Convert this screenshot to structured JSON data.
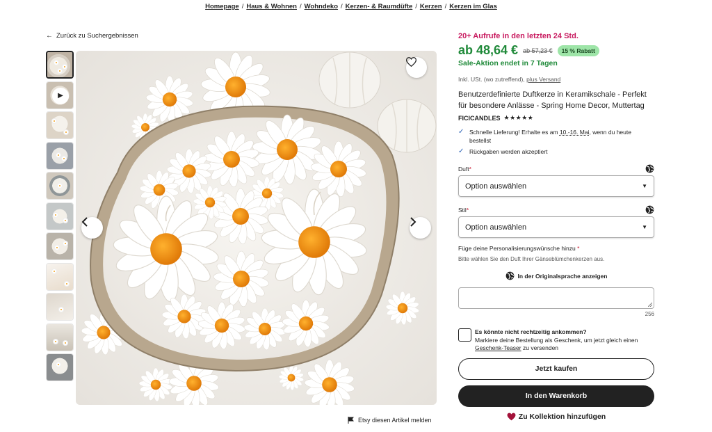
{
  "breadcrumb": {
    "items": [
      "Homepage",
      "Haus & Wohnen",
      "Wohndeko",
      "Kerzen- & Raumdüfte",
      "Kerzen",
      "Kerzen im Glas"
    ],
    "separator": "/"
  },
  "back_link": "Zurück zu Suchergebnissen",
  "gallery": {
    "report_link": "Etsy diesen Artikel melden"
  },
  "product": {
    "views_text": "20+ Aufrufe in den letzten 24 Std.",
    "price": "ab 48,64 €",
    "old_price": "ab 57,23 €",
    "discount_badge": "15 % Rabatt",
    "sale_end": "Sale-Aktion endet in 7 Tagen",
    "tax_text": "Inkl. USt. (wo zutreffend),",
    "shipping_link": "plus Versand",
    "title": "Benutzerdefinierte Duftkerze in Keramikschale - Perfekt für besondere Anlässe - Spring Home Decor, Muttertag",
    "shop_name": "FICICANDLES",
    "stars": "★★★★★"
  },
  "features": {
    "delivery_prefix": "Schnelle Lieferung! Erhalte es am",
    "delivery_date": "10.-16. Mai",
    "delivery_suffix": ", wenn du heute bestellst",
    "returns": "Rückgaben werden akzeptiert"
  },
  "options": {
    "scent_label": "Duft",
    "scent_value": "Option auswählen",
    "style_label": "Stil",
    "style_value": "Option auswählen",
    "required_mark": "*"
  },
  "personalization": {
    "label": "Füge deine Personalisierungswünsche hinzu",
    "hint": "Bitte wählen Sie den Duft Ihrer Gänseblümchenkerzen aus.",
    "translate_link": "In der Originalsprache anzeigen",
    "counter": "256"
  },
  "gift": {
    "title": "Es könnte nicht rechtzeitig ankommen?",
    "text_prefix": "Markiere deine Bestellung als Geschenk, um jetzt gleich einen",
    "link": "Geschenk-Teaser",
    "text_suffix": "zu versenden"
  },
  "buttons": {
    "buy_now": "Jetzt kaufen",
    "add_to_cart": "In den Warenkorb",
    "add_to_collection": "Zu Kollektion hinzufügen"
  },
  "colors": {
    "views": "#c81a5f",
    "price": "#208a3a",
    "discount_bg": "#9ee5a8",
    "primary_button": "#222222",
    "check": "#2a61b6",
    "heart": "#a3123a"
  }
}
